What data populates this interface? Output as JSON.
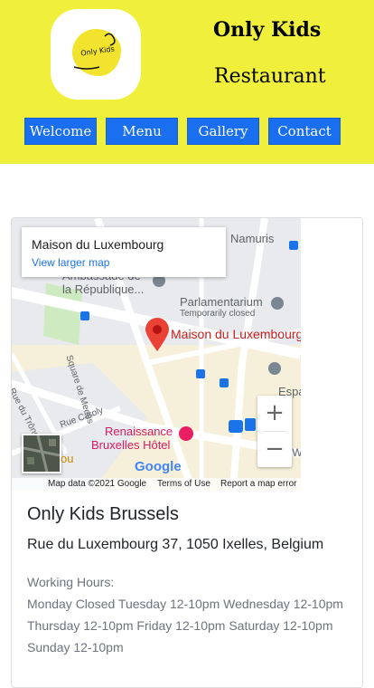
{
  "header": {
    "logo_text": "Only Kids",
    "title_line1": "Only Kids",
    "title_line2": "Restaurant",
    "background": "#f0f03c"
  },
  "nav": {
    "items": [
      {
        "label": "Welcome"
      },
      {
        "label": "Menu"
      },
      {
        "label": "Gallery"
      },
      {
        "label": "Contact"
      }
    ],
    "button_color": "#1a6ff0"
  },
  "map": {
    "info_title": "Maison du Luxembourg",
    "info_link": "View larger map",
    "marker_label": "Maison du Luxembourg",
    "labels": {
      "namuris": "Namuris",
      "ambassade1": "Ambassade de",
      "ambassade2": "la République...",
      "parlamentarium": "Parlamentarium",
      "temporarily_closed": "Temporarily closed",
      "square_de_meeus": "Square de Meeûs",
      "rue_du_trone": "Rue du Trône",
      "rue_caroly": "Rue Caroly",
      "renaissance1": "Renaissance",
      "renaissance2": "Bruxelles Hôtel",
      "espace_l": "Espace L",
      "mw": "M W"
    },
    "google_logo": "Google",
    "footer": {
      "map_data": "Map data ©2021 Google",
      "terms": "Terms of Use",
      "report": "Report a map error"
    },
    "zoom_in": "+",
    "zoom_out": "−"
  },
  "location": {
    "name": "Only Kids Brussels",
    "address": "Rue du Luxembourg 37, 1050 Ixelles, Belgium",
    "hours_title": "Working Hours:",
    "hours_text": "Monday Closed Tuesday 12-10pm Wednesday 12-10pm Thursday 12-10pm Friday 12-10pm Saturday 12-10pm Sunday 12-10pm"
  }
}
